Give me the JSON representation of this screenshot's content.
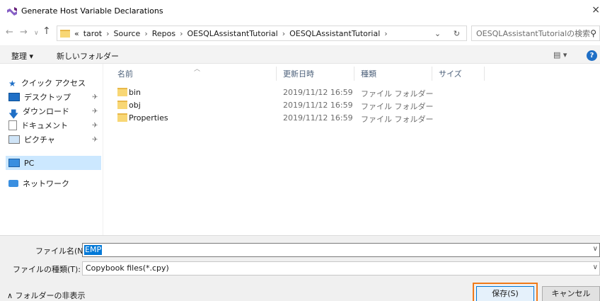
{
  "window": {
    "title": "Generate Host Variable Declarations",
    "close_glyph": "×"
  },
  "address": {
    "overflow": "«",
    "crumbs": [
      "tarot",
      "Source",
      "Repos",
      "OESQLAssistantTutorial",
      "OESQLAssistantTutorial"
    ],
    "separator": "›",
    "dropdown_glyph": "⌄",
    "refresh_glyph": "↻"
  },
  "search": {
    "placeholder": "OESQLAssistantTutorialの検索",
    "icon": "search-icon"
  },
  "toolbar": {
    "organize_label": "整理 ▾",
    "new_folder_label": "新しいフォルダー",
    "view_label": "▤ ▾",
    "help_label": "?"
  },
  "nav": {
    "quick_access": "クイック アクセス",
    "items": [
      {
        "label": "デスクトップ",
        "icon": "desktop-icon",
        "pinned": true
      },
      {
        "label": "ダウンロード",
        "icon": "download-icon",
        "pinned": true
      },
      {
        "label": "ドキュメント",
        "icon": "document-icon",
        "pinned": true
      },
      {
        "label": "ピクチャ",
        "icon": "picture-icon",
        "pinned": true
      }
    ],
    "pc": "PC",
    "network": "ネットワーク",
    "pin_glyph": "📌"
  },
  "columns": {
    "name": "名前",
    "date": "更新日時",
    "type": "種類",
    "size": "サイズ"
  },
  "files": [
    {
      "name": "bin",
      "date": "2019/11/12 16:59",
      "type": "ファイル フォルダー"
    },
    {
      "name": "obj",
      "date": "2019/11/12 16:59",
      "type": "ファイル フォルダー"
    },
    {
      "name": "Properties",
      "date": "2019/11/12 16:59",
      "type": "ファイル フォルダー"
    }
  ],
  "form": {
    "filename_label": "ファイル名(N):",
    "filename_value": "EMP",
    "filetype_label": "ファイルの種類(T):",
    "filetype_value": "Copybook files(*.cpy)",
    "hide_folders": "∧ フォルダーの非表示",
    "save_label": "保存(S)",
    "cancel_label": "キャンセル"
  },
  "colors": {
    "accent": "#0078d7",
    "highlight": "#f07a1a",
    "folder": "#f8d775"
  }
}
